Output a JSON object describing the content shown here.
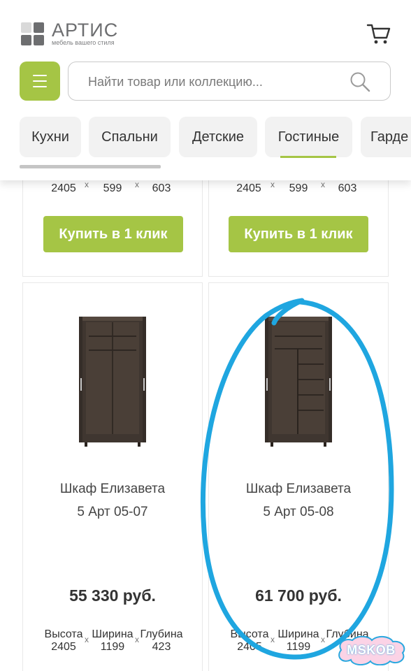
{
  "header": {
    "logo_name": "АРТИС",
    "logo_tagline": "мебель вашего стиля",
    "search_placeholder": "Найти товар или коллекцию...",
    "colors": {
      "accent": "#a5c545",
      "logo_gray": "#6d6e70"
    }
  },
  "categories": [
    {
      "label": "Кухни",
      "active": false
    },
    {
      "label": "Спальни",
      "active": false
    },
    {
      "label": "Детские",
      "active": false
    },
    {
      "label": "Гостиные",
      "active": true
    },
    {
      "label": "Гарде",
      "active": false
    }
  ],
  "top_cards": [
    {
      "dims": {
        "height": "2405",
        "width": "599",
        "depth": "603"
      },
      "dim_separator": "x",
      "buy_label": "Купить в 1 клик"
    },
    {
      "dims": {
        "height": "2405",
        "width": "599",
        "depth": "603"
      },
      "dim_separator": "x",
      "buy_label": "Купить в 1 клик"
    }
  ],
  "products": [
    {
      "name": "Шкаф Елизавета",
      "code": "5 Арт 05-07",
      "price": "55 330 руб.",
      "dim_labels": {
        "height": "Высота",
        "width": "Ширина",
        "depth": "Глубина"
      },
      "dims": {
        "height": "2405",
        "width": "1199",
        "depth": "423"
      },
      "dim_separator": "x",
      "image": "wardrobe-two-door-icon"
    },
    {
      "name": "Шкаф Елизавета",
      "code": "5 Арт 05-08",
      "price": "61 700 руб.",
      "dim_labels": {
        "height": "Высота",
        "width": "Ширина",
        "depth": "Глубина"
      },
      "dims": {
        "height": "2405",
        "width": "1199",
        "depth": ""
      },
      "dim_separator": "x",
      "image": "wardrobe-with-shelves-icon"
    }
  ],
  "annotation": {
    "color": "#1fa6e0",
    "shape": "hand-drawn-ellipse"
  },
  "watermark": {
    "text": "MSKOB"
  }
}
